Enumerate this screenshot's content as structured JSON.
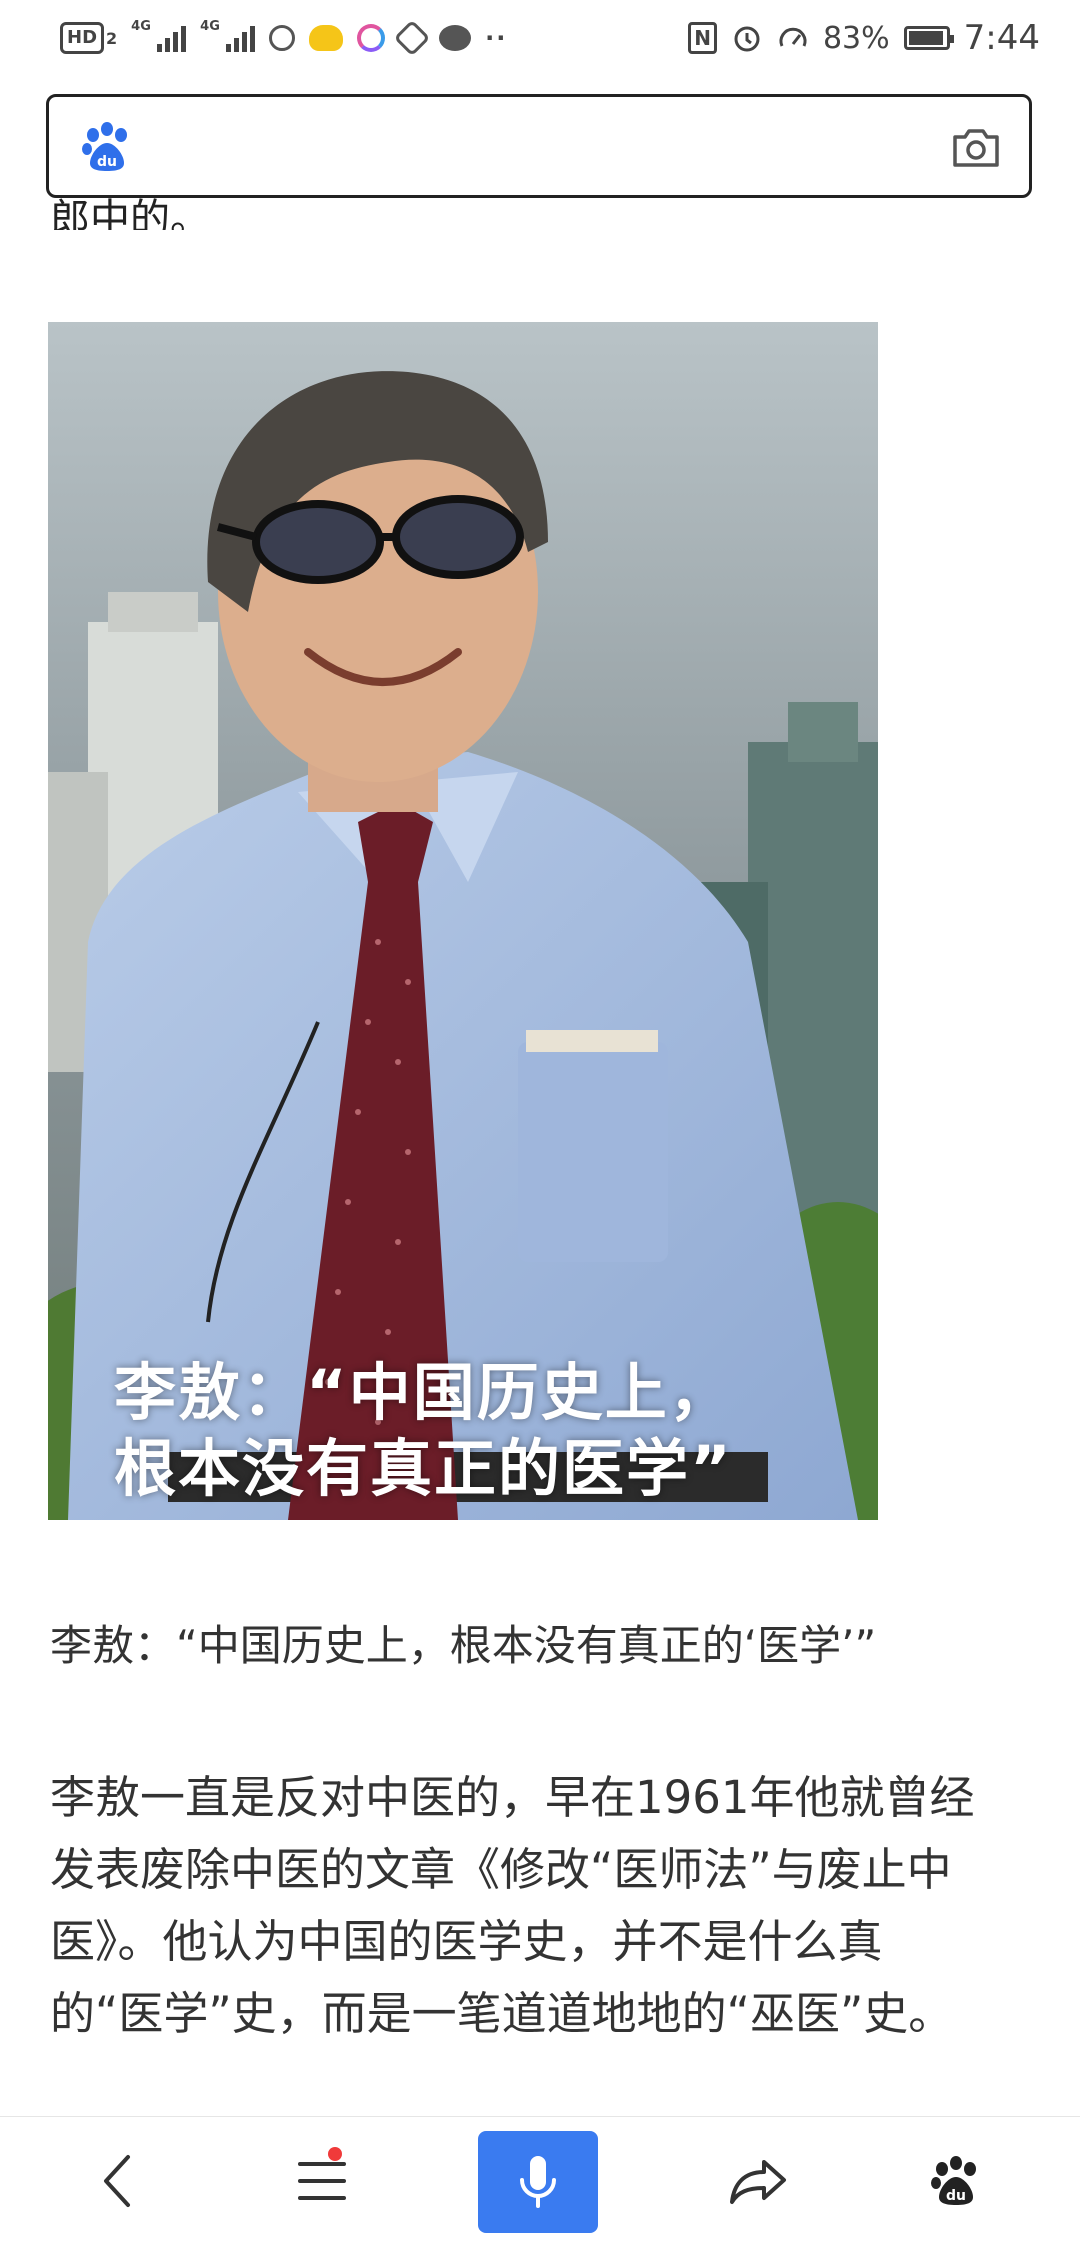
{
  "status_bar": {
    "hd_label": "HD",
    "hd_sub": "2",
    "signal1": "4G",
    "signal2": "4G",
    "nfc": "N",
    "battery": "83%",
    "time": "7:44",
    "dots": "··"
  },
  "search": {
    "placeholder": ""
  },
  "article": {
    "clipped_line": "郎中的。",
    "image_overlay_line1": "李敖：“中国历史上，",
    "image_overlay_line2": "根本没有真正的医学”",
    "image_caption": "李敖：“中国历史上，根本没有真正的‘医学’”",
    "paragraph_lines": [
      "李敖一直是反对中医的，早在1961年他就曾经",
      "发表废除中医的文章《修改“医师法”与废止中",
      "医》。他认为中国的医学史，并不是什么真",
      "的“医学”史，而是一笔道道地地的“巫医”史。"
    ]
  },
  "bottom_nav": {
    "accent_color": "#3a7bf0",
    "items": [
      "back-icon",
      "menu-icon",
      "microphone-icon",
      "share-icon",
      "baidu-icon"
    ]
  }
}
